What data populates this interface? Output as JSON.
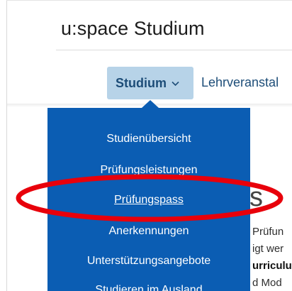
{
  "header": {
    "app_title": "u:space Studium"
  },
  "nav": {
    "active_label": "Studium",
    "active_chevron": "chevron-down-icon",
    "next_label": "Lehrveranstal"
  },
  "dropdown": {
    "items": [
      {
        "label": "Studienübersicht"
      },
      {
        "label": "Prüfungsleistungen"
      },
      {
        "label": "Prüfungspass"
      },
      {
        "label": "Anerkennungen"
      },
      {
        "label": "Unterstützungsangebote"
      },
      {
        "label": "Studieren im Ausland"
      }
    ]
  },
  "page": {
    "partial_heading": "s",
    "partial_lines": [
      "Prüfun",
      "igt wer",
      "urriculu",
      "d Mod"
    ]
  },
  "colors": {
    "dropdown_bg": "#0b5db3",
    "active_tab_bg": "#b7d3e8",
    "nav_text": "#1d4d78",
    "annotation": "#e8000b"
  },
  "annotation": {
    "shape": "red-ellipse-highlight",
    "target": "Prüfungspass"
  }
}
